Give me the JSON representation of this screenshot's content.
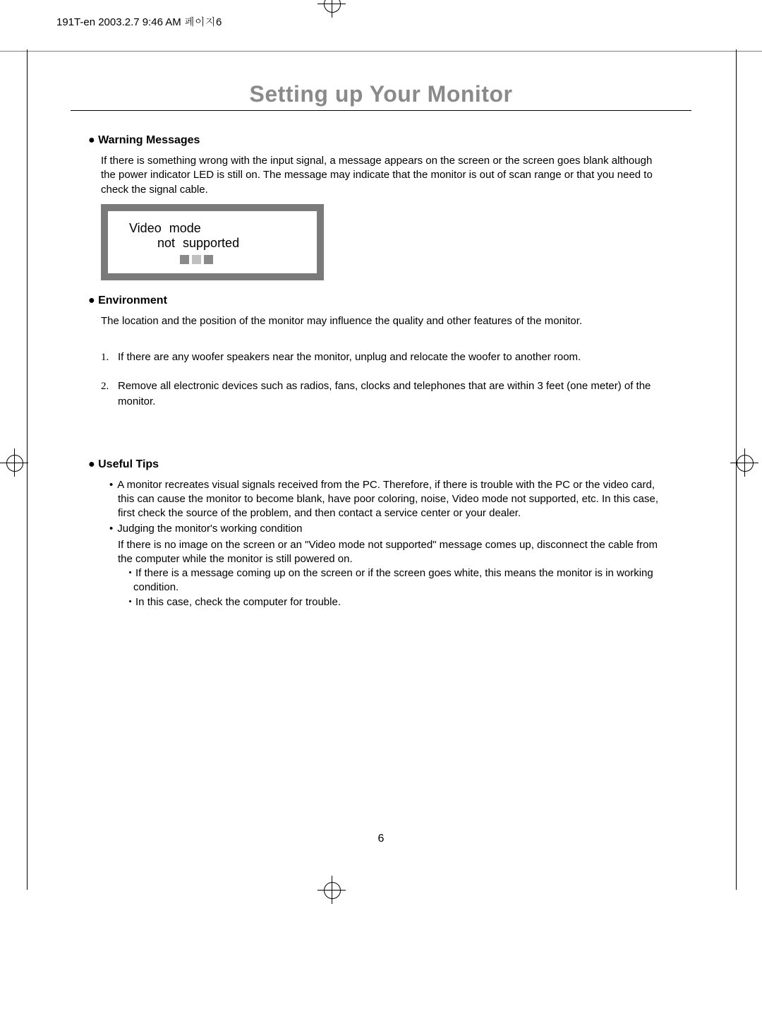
{
  "header_label": "191T-en  2003.2.7 9:46 AM  페이지6",
  "title": "Setting up Your Monitor",
  "page_number": "6",
  "sections": {
    "warning": {
      "heading": "Warning Messages",
      "body": "If there is something wrong with the input signal, a message appears on the screen or the screen goes blank although the power indicator LED is still on. The message may indicate that the monitor is out of scan range or that you need to check the signal cable.",
      "monitor_line1": "Video  mode",
      "monitor_line2": "not   supported"
    },
    "environment": {
      "heading": "Environment",
      "body": "The location and the position of the monitor may influence the quality and other features of the monitor.",
      "items": [
        {
          "num": "1.",
          "text": "If there are any woofer speakers near the monitor, unplug and relocate the woofer to another room."
        },
        {
          "num": "2.",
          "text": "Remove all electronic devices such as radios, fans, clocks and telephones that are within 3 feet (one meter) of the monitor."
        }
      ]
    },
    "tips": {
      "heading": "Useful Tips",
      "bullets": [
        "A monitor recreates visual signals received from the PC. Therefore, if there is trouble with the PC or the video card, this can cause the monitor to become blank, have poor coloring, noise, Video mode not supported, etc. In this case, first check the source of the problem, and then contact a service center or your dealer.",
        "Judging the monitor's working condition"
      ],
      "followup": "If there is no image on the screen or an \"Video mode not supported\" message comes up, disconnect the cable from the computer while the monitor is still powered on.",
      "subbullets": [
        "If there is a message coming up on the screen or if the screen goes white, this means the monitor is in working condition.",
        "In this case, check the computer for trouble."
      ]
    }
  }
}
